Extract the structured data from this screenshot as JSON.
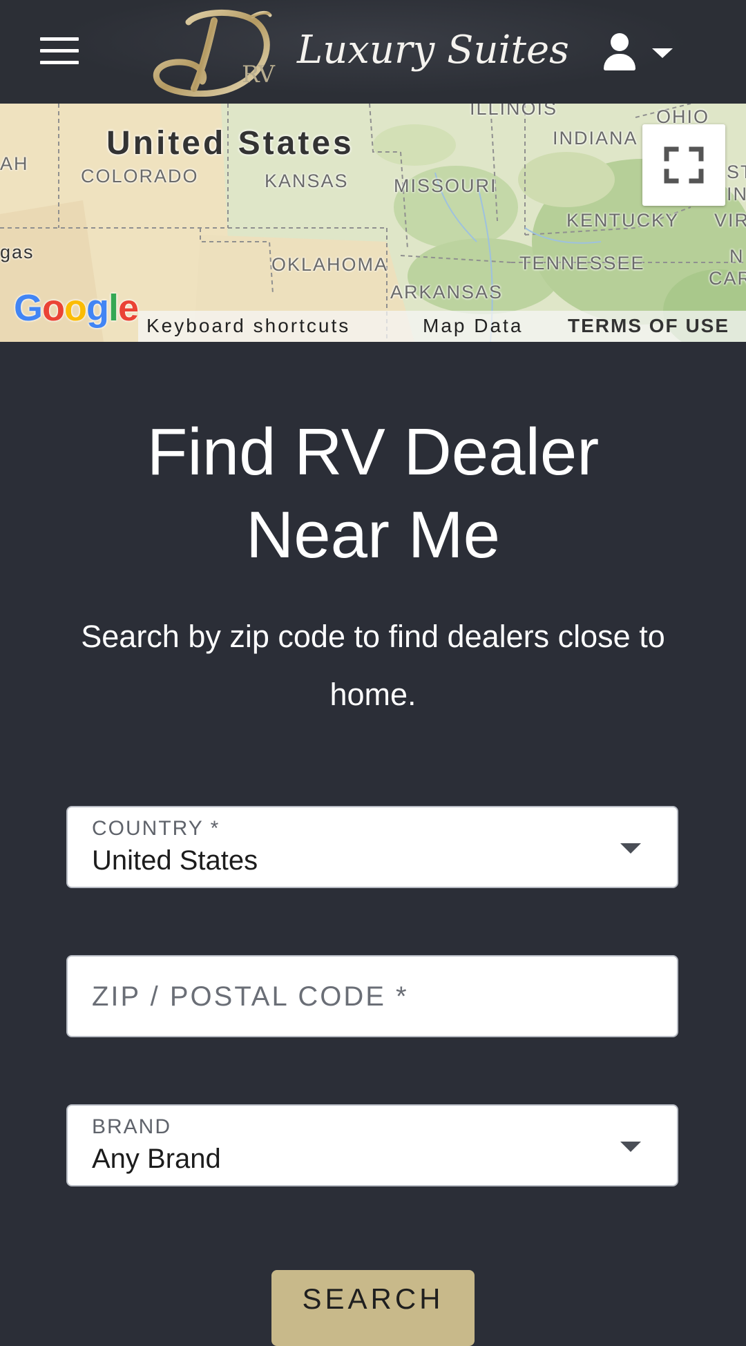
{
  "header": {
    "menu_icon": "hamburger-menu-icon",
    "logo": {
      "mark_letter": "D",
      "mark_sub": "RV",
      "text": "Luxury Suites"
    },
    "user_icon": "user-icon",
    "user_caret_icon": "caret-down-icon"
  },
  "map": {
    "country_label": "United States",
    "state_labels": {
      "illinois": "ILLINOIS",
      "ohio": "OHIO",
      "indiana": "INDIANA",
      "colorado": "COLORADO",
      "kansas": "KANSAS",
      "missouri": "MISSOURI",
      "kentucky": "KENTUCKY",
      "oklahoma": "OKLAHOMA",
      "tennessee": "TENNESSEE",
      "arkansas": "ARKANSAS",
      "utah_partial": "AH",
      "vegas_partial": "gas",
      "st_partial": "ST",
      "in_partial": "IN",
      "vir_partial": "VIR",
      "n_partial": "N",
      "car_partial": "CAR"
    },
    "fullscreen_icon": "fullscreen-icon",
    "google_logo": "Google",
    "footer": {
      "keyboard_shortcuts": "Keyboard shortcuts",
      "map_data": "Map Data",
      "terms": "TERMS OF USE"
    },
    "colors": {
      "land": "#dfe6c8",
      "forest": "#b9d3a1",
      "plains": "#f2e6c6"
    }
  },
  "main": {
    "title_line1": "Find RV Dealer",
    "title_line2": "Near Me",
    "subtitle": "Search by zip code to find dealers close to home.",
    "country_field": {
      "label": "COUNTRY *",
      "value": "United States"
    },
    "zip_field": {
      "placeholder": "ZIP / POSTAL CODE *",
      "value": ""
    },
    "brand_field": {
      "label": "BRAND",
      "value": "Any Brand"
    },
    "search_button": "SEARCH"
  },
  "colors": {
    "background": "#2b2e37",
    "header": "#2c2f36",
    "accent_gold": "#c8b98a",
    "text_light": "#ffffff"
  }
}
